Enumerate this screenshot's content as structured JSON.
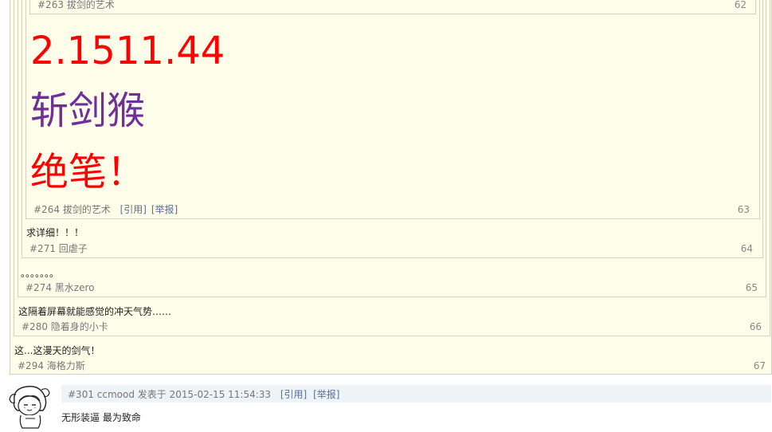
{
  "quotes": {
    "q263": {
      "author": "#263 拔剑的艺术",
      "floor": "62"
    },
    "q264": {
      "line1": "2.1511.44",
      "line2": "斩剑猴",
      "line3": "绝笔！",
      "author": "#264 拔剑的艺术",
      "cite": "[引用]",
      "report": "[举报]",
      "floor": "63",
      "colors": {
        "line1": "#ff0000",
        "line2": "#6f3198",
        "line3": "#ff0000"
      }
    },
    "q271": {
      "text": "求详细！！！",
      "author": "#271 回虐子",
      "floor": "64"
    },
    "q274": {
      "text": "。。。。。。。",
      "author": "#274 黑水zero",
      "floor": "65"
    },
    "q280": {
      "text": "这隔着屏幕就能感觉的冲天气势……",
      "author": "#280 隐着身的小卡",
      "floor": "66"
    },
    "q294": {
      "text": "这...这漫天的剑气！",
      "author": "#294 海格力斯",
      "floor": "67"
    }
  },
  "post": {
    "author_line": "#301 ccmood 发表于 2015-02-15 11:54:33",
    "cite": "[引用]",
    "report": "[举报]",
    "content": "无形装逼 最为致命"
  },
  "colors": {
    "quote_bg": "#fefde9",
    "quote_border": "#d2d2c2",
    "post_bar_bg": "#eef3f8",
    "link": "#5a6ea0"
  }
}
